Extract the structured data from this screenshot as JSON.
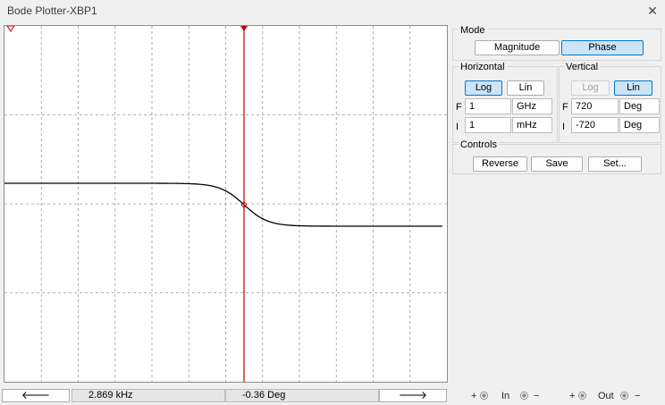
{
  "window": {
    "title": "Bode Plotter-XBP1",
    "close_glyph": "✕"
  },
  "plot": {
    "background": "#ffffff",
    "curve_color": "#000000",
    "cursor_color": "#c00000",
    "grid_color": "#9a9a9a"
  },
  "mode": {
    "label": "Mode",
    "magnitude_label": "Magnitude",
    "phase_label": "Phase",
    "selected": "Phase"
  },
  "horizontal": {
    "label": "Horizontal",
    "log_label": "Log",
    "lin_label": "Lin",
    "selected": "Log",
    "final_letter": "F",
    "initial_letter": "I",
    "final_value": "1",
    "final_unit": "GHz",
    "initial_value": "1",
    "initial_unit": "mHz"
  },
  "vertical": {
    "label": "Vertical",
    "log_label": "Log",
    "lin_label": "Lin",
    "selected": "Lin",
    "final_letter": "F",
    "initial_letter": "I",
    "final_value": "720",
    "final_unit": "Deg",
    "initial_value": "-720",
    "initial_unit": "Deg"
  },
  "controls": {
    "label": "Controls",
    "reverse_label": "Reverse",
    "save_label": "Save",
    "set_label": "Set..."
  },
  "bottom": {
    "left_arrow": "🡐",
    "right_arrow": "🡒",
    "frequency_readout": "2.869 kHz",
    "value_readout": "-0.36 Deg",
    "in_plus": "+",
    "in_label": "In",
    "in_minus": "−",
    "out_plus": "+",
    "out_label": "Out",
    "out_minus": "−"
  }
}
